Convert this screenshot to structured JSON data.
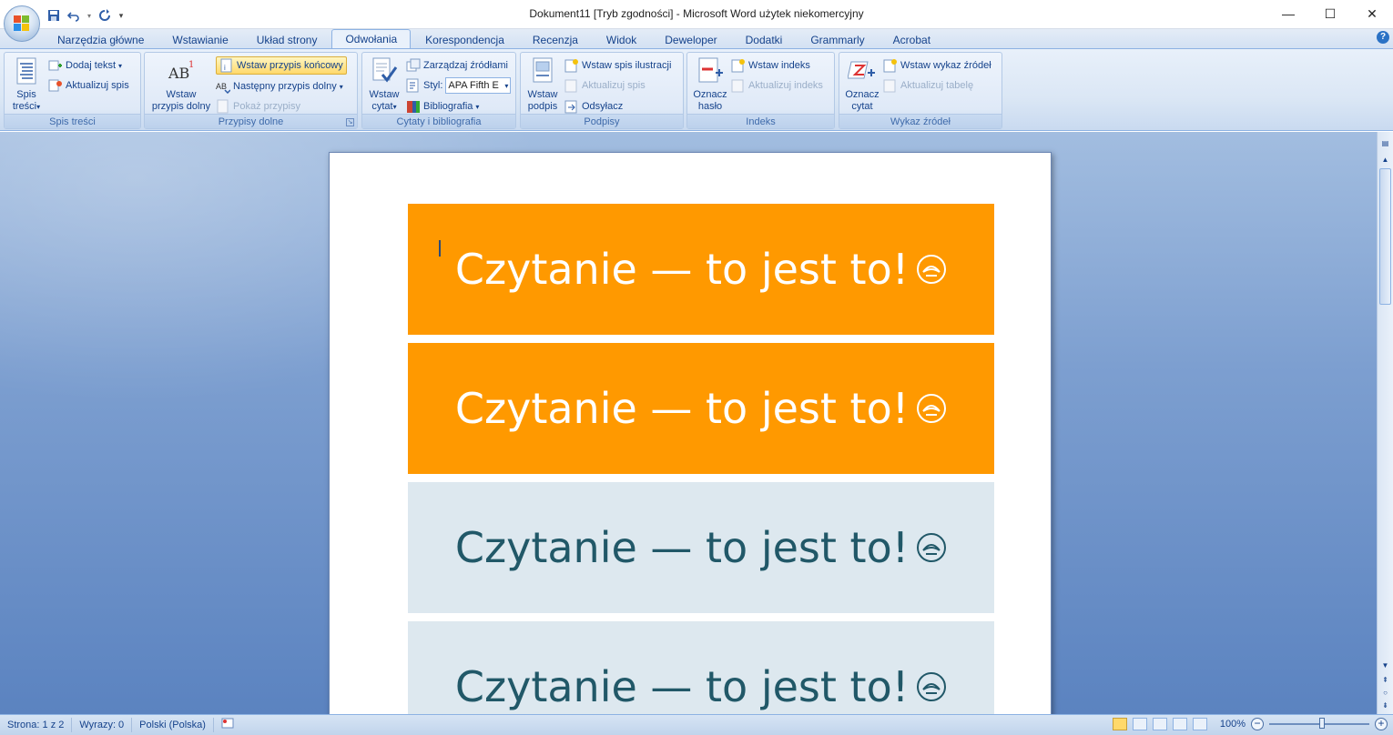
{
  "window": {
    "title": "Dokument11 [Tryb zgodności] - Microsoft Word użytek niekomercyjny",
    "minimize": "—",
    "maximize": "☐",
    "close": "✕"
  },
  "qat": {
    "more": "▾"
  },
  "tabs": [
    {
      "label": "Narzędzia główne"
    },
    {
      "label": "Wstawianie"
    },
    {
      "label": "Układ strony"
    },
    {
      "label": "Odwołania",
      "active": true
    },
    {
      "label": "Korespondencja"
    },
    {
      "label": "Recenzja"
    },
    {
      "label": "Widok"
    },
    {
      "label": "Deweloper"
    },
    {
      "label": "Dodatki"
    },
    {
      "label": "Grammarly"
    },
    {
      "label": "Acrobat"
    }
  ],
  "help": "?",
  "ribbon": {
    "toc": {
      "label": "Spis treści",
      "big_button_line1": "Spis",
      "big_button_line2": "treści",
      "add_text": "Dodaj tekst",
      "update_toc": "Aktualizuj spis"
    },
    "footnotes": {
      "label": "Przypisy dolne",
      "insert_footnote_line1": "Wstaw",
      "insert_footnote_line2": "przypis dolny",
      "insert_endnote": "Wstaw przypis końcowy",
      "next_footnote": "Następny przypis dolny",
      "show_notes": "Pokaż przypisy"
    },
    "citations": {
      "label": "Cytaty i bibliografia",
      "insert_citation_line1": "Wstaw",
      "insert_citation_line2": "cytat",
      "manage_sources": "Zarządzaj źródłami",
      "style_label": "Styl:",
      "style_value": "APA Fifth E",
      "bibliography": "Bibliografia"
    },
    "captions": {
      "label": "Podpisy",
      "insert_caption_line1": "Wstaw",
      "insert_caption_line2": "podpis",
      "insert_table_of_figures": "Wstaw spis ilustracji",
      "update_table": "Aktualizuj spis",
      "cross_reference": "Odsyłacz"
    },
    "index": {
      "label": "Indeks",
      "mark_entry_line1": "Oznacz",
      "mark_entry_line2": "hasło",
      "insert_index": "Wstaw indeks",
      "update_index": "Aktualizuj indeks"
    },
    "authorities": {
      "label": "Wykaz źródeł",
      "mark_citation_line1": "Oznacz",
      "mark_citation_line2": "cytat",
      "insert_table": "Wstaw wykaz źródeł",
      "update_table": "Aktualizuj tabelę"
    }
  },
  "document": {
    "bands": [
      {
        "text": "Czytanie — to jest to!",
        "style": "orange"
      },
      {
        "text": "Czytanie — to jest to!",
        "style": "orange"
      },
      {
        "text": "Czytanie — to jest to!",
        "style": "light"
      },
      {
        "text": "Czytanie — to jest to!",
        "style": "light"
      }
    ]
  },
  "colors": {
    "orange_band": "#ff9900",
    "light_band": "#dde8ef",
    "light_text": "#215868",
    "accent": "#15428b"
  },
  "status": {
    "page": "Strona: 1 z 2",
    "words": "Wyrazy: 0",
    "language": "Polski (Polska)",
    "zoom": "100%",
    "zoom_minus": "−",
    "zoom_plus": "+"
  }
}
